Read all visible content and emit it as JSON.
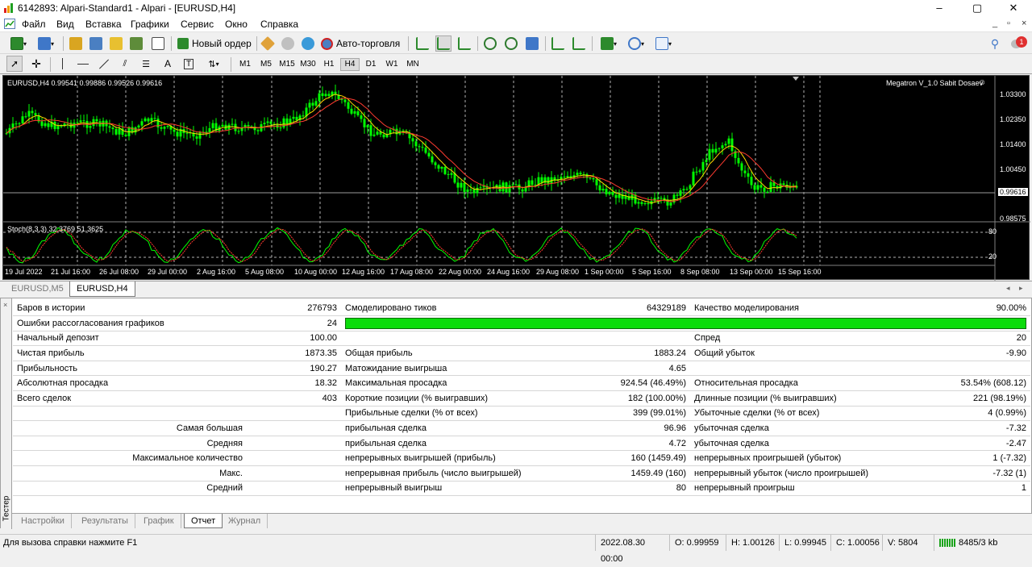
{
  "window": {
    "title": "6142893: Alpari-Standard1 - Alpari - [EURUSD,H4]"
  },
  "window_controls": {
    "minimize": "–",
    "maximize": "▢",
    "close": "✕"
  },
  "mdi_controls": {
    "minimize": "_",
    "restore": "▫",
    "close": "×"
  },
  "menu": [
    "Файл",
    "Вид",
    "Вставка",
    "Графики",
    "Сервис",
    "Окно",
    "Справка"
  ],
  "toolbar": {
    "new_order": "Новый ордер",
    "auto_trading": "Авто-торговля",
    "notification_count": "1"
  },
  "drawing_toolbar": {
    "text_tool": "A",
    "label_tool": "T"
  },
  "timeframes": [
    "M1",
    "M5",
    "M15",
    "M30",
    "H1",
    "H4",
    "D1",
    "W1",
    "MN"
  ],
  "active_timeframe": "H4",
  "chart": {
    "info": "EURUSD,H4  0.99541 0.99886 0.99526 0.99616",
    "indicator_name": "Megatron V_1.0 Sabit Dosaev",
    "price_labels": [
      "1.03300",
      "1.02350",
      "1.01400",
      "1.00450",
      "0.99616",
      "0.98575"
    ],
    "current_price": "0.99616",
    "stoch_label": "Stoch(8,3,3) 32.3769 51.3625",
    "stoch_levels": [
      "80",
      "20"
    ],
    "time_labels": [
      "19 Jul 2022",
      "21 Jul 16:00",
      "26 Jul 08:00",
      "29 Jul 00:00",
      "2 Aug 16:00",
      "5 Aug 08:00",
      "10 Aug 00:00",
      "12 Aug 16:00",
      "17 Aug 08:00",
      "22 Aug 00:00",
      "24 Aug 16:00",
      "29 Aug 08:00",
      "1 Sep 00:00",
      "5 Sep 16:00",
      "8 Sep 08:00",
      "13 Sep 00:00",
      "15 Sep 16:00"
    ],
    "colors": {
      "candles": "#00ff00",
      "ma_fast": "#ffd700",
      "ma_slow": "#ff3b30",
      "stoch_main": "#00ff00",
      "stoch_signal": "#ff3b30"
    }
  },
  "chart_tabs": [
    "EURUSD,M5",
    "EURUSD,H4"
  ],
  "active_chart_tab": "EURUSD,H4",
  "report": {
    "rows": [
      [
        "Баров в истории",
        "276793",
        "Смоделировано тиков",
        "64329189",
        "Качество моделирования",
        "90.00%"
      ],
      [
        "Ошибки рассогласования графиков",
        "24",
        "",
        "",
        "",
        ""
      ],
      [
        "Начальный депозит",
        "100.00",
        "",
        "",
        "Спред",
        "20"
      ],
      [
        "Чистая прибыль",
        "1873.35",
        "Общая прибыль",
        "1883.24",
        "Общий убыток",
        "-9.90"
      ],
      [
        "Прибыльность",
        "190.27",
        "Матожидание выигрыша",
        "4.65",
        "",
        ""
      ],
      [
        "Абсолютная просадка",
        "18.32",
        "Максимальная просадка",
        "924.54 (46.49%)",
        "Относительная просадка",
        "53.54% (608.12)"
      ],
      [
        "Всего сделок",
        "403",
        "Короткие позиции (% выигравших)",
        "182 (100.00%)",
        "Длинные позиции (% выигравших)",
        "221 (98.19%)"
      ],
      [
        "",
        "",
        "Прибыльные сделки (% от всех)",
        "399 (99.01%)",
        "Убыточные сделки (% от всех)",
        "4 (0.99%)"
      ],
      [
        "Самая большая",
        "",
        "прибыльная сделка",
        "96.96",
        "убыточная сделка",
        "-7.32"
      ],
      [
        "Средняя",
        "",
        "прибыльная сделка",
        "4.72",
        "убыточная сделка",
        "-2.47"
      ],
      [
        "Максимальное количество",
        "",
        "непрерывных выигрышей (прибыль)",
        "160 (1459.49)",
        "непрерывных проигрышей (убыток)",
        "1 (-7.32)"
      ],
      [
        "Макс.",
        "",
        "непрерывная прибыль (число выигрышей)",
        "1459.49 (160)",
        "непрерывный убыток (число проигрышей)",
        "-7.32 (1)"
      ],
      [
        "Средний",
        "",
        "непрерывный выигрыш",
        "80",
        "непрерывный проигрыш",
        "1"
      ]
    ],
    "modeling_quality_fraction": 1.0
  },
  "tester_label": "Тестер",
  "bottom_tabs": [
    "Настройки",
    "Результаты",
    "График",
    "Отчет",
    "Журнал"
  ],
  "active_bottom_tab": "Отчет",
  "status": {
    "help": "Для вызова справки нажмите F1",
    "datetime": "2022.08.30 00:00",
    "open": "O: 0.99959",
    "high": "H: 1.00126",
    "low": "L: 0.99945",
    "close": "C: 1.00056",
    "volume": "V: 5804",
    "traffic": "8485/3 kb"
  }
}
